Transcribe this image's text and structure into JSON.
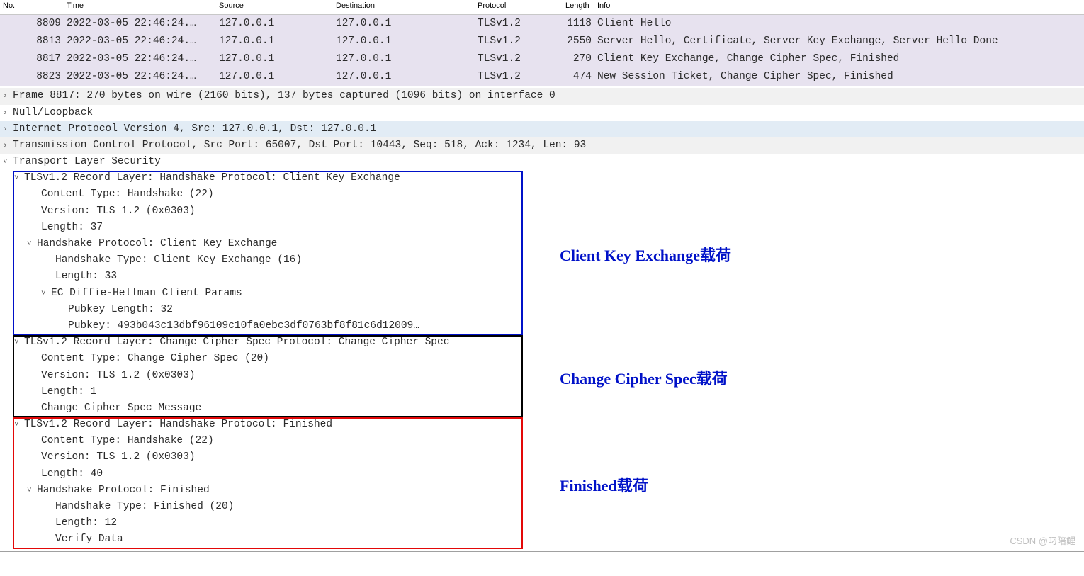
{
  "columns": {
    "no": "No.",
    "time": "Time",
    "source": "Source",
    "destination": "Destination",
    "protocol": "Protocol",
    "length": "Length",
    "info": "Info"
  },
  "packets": [
    {
      "no": "8809",
      "time": "2022-03-05 22:46:24.…",
      "src": "127.0.0.1",
      "dst": "127.0.0.1",
      "proto": "TLSv1.2",
      "len": "1118",
      "info": "Client Hello",
      "cls": "row-tls"
    },
    {
      "no": "8813",
      "time": "2022-03-05 22:46:24.…",
      "src": "127.0.0.1",
      "dst": "127.0.0.1",
      "proto": "TLSv1.2",
      "len": "2550",
      "info": "Server Hello, Certificate, Server Key Exchange, Server Hello Done",
      "cls": "row-tls"
    },
    {
      "no": "8817",
      "time": "2022-03-05 22:46:24.…",
      "src": "127.0.0.1",
      "dst": "127.0.0.1",
      "proto": "TLSv1.2",
      "len": "270",
      "info": "Client Key Exchange, Change Cipher Spec, Finished",
      "cls": "row-tls"
    },
    {
      "no": "8823",
      "time": "2022-03-05 22:46:24.…",
      "src": "127.0.0.1",
      "dst": "127.0.0.1",
      "proto": "TLSv1.2",
      "len": "474",
      "info": "New Session Ticket, Change Cipher Spec, Finished",
      "cls": "row-tls"
    }
  ],
  "details": {
    "frame": "Frame 8817: 270 bytes on wire (2160 bits), 137 bytes captured (1096 bits) on interface 0",
    "nullloop": "Null/Loopback",
    "ip": "Internet Protocol Version 4, Src: 127.0.0.1, Dst: 127.0.0.1",
    "tcp": "Transmission Control Protocol, Src Port: 65007, Dst Port: 10443, Seq: 518, Ack: 1234, Len: 93",
    "tls": "Transport Layer Security",
    "rec1": {
      "title": "TLSv1.2 Record Layer: Handshake Protocol: Client Key Exchange",
      "ctype": "Content Type: Handshake (22)",
      "version": "Version: TLS 1.2 (0x0303)",
      "length": "Length: 37",
      "hs_title": "Handshake Protocol: Client Key Exchange",
      "hs_type": "Handshake Type: Client Key Exchange (16)",
      "hs_len": "Length: 33",
      "ecdh_title": "EC Diffie-Hellman Client Params",
      "pubkey_len": "Pubkey Length: 32",
      "pubkey": "Pubkey: 493b043c13dbf96109c10fa0ebc3df0763bf8f81c6d12009…"
    },
    "rec2": {
      "title": "TLSv1.2 Record Layer: Change Cipher Spec Protocol: Change Cipher Spec",
      "ctype": "Content Type: Change Cipher Spec (20)",
      "version": "Version: TLS 1.2 (0x0303)",
      "length": "Length: 1",
      "msg": "Change Cipher Spec Message"
    },
    "rec3": {
      "title": "TLSv1.2 Record Layer: Handshake Protocol: Finished",
      "ctype": "Content Type: Handshake (22)",
      "version": "Version: TLS 1.2 (0x0303)",
      "length": "Length: 40",
      "hs_title": "Handshake Protocol: Finished",
      "hs_type": "Handshake Type: Finished (20)",
      "hs_len": "Length: 12",
      "verify": "Verify Data"
    }
  },
  "annotations": {
    "label1": "Client Key Exchange载荷",
    "label2": "Change Cipher Spec载荷",
    "label3": "Finished载荷"
  },
  "watermark": "CSDN @叼陪鲤"
}
